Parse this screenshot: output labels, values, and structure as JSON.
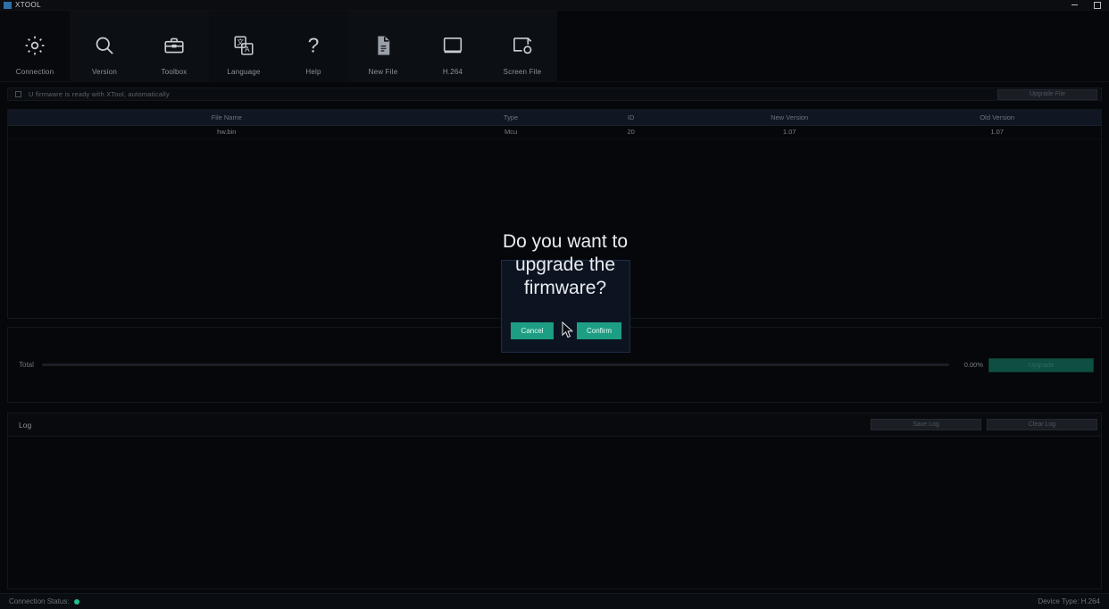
{
  "window": {
    "title": "XTOOL",
    "minimize_label": "Minimize",
    "maximize_label": "Maximize"
  },
  "toolbar": {
    "items": [
      {
        "label": "Connection",
        "icon": "gear-icon"
      },
      {
        "label": "Version",
        "icon": "magnifier-icon"
      },
      {
        "label": "Toolbox",
        "icon": "toolbox-icon"
      },
      {
        "label": "Language",
        "icon": "translate-icon"
      },
      {
        "label": "Help",
        "icon": "question-mark-icon"
      },
      {
        "label": "New File",
        "icon": "document-icon"
      },
      {
        "label": "H.264",
        "icon": "screen-icon"
      },
      {
        "label": "Screen File",
        "icon": "screen-settings-icon"
      }
    ]
  },
  "auto_update": {
    "checkbox_checked": false,
    "label": "U firmware is ready with XTool, automatically",
    "action_label": "Upgrade File"
  },
  "firmware_table": {
    "columns": [
      "File Name",
      "Type",
      "ID",
      "New Version",
      "Old Version"
    ],
    "rows": [
      {
        "file_name": "hw.bin",
        "type": "Mcu",
        "id": "20",
        "new_version": "1.07",
        "old_version": "1.07"
      }
    ]
  },
  "progress": {
    "label": "Total",
    "percent_text": "0.00%",
    "percent_value": 0,
    "upgrade_label": "Upgrade"
  },
  "log": {
    "label": "Log",
    "save_label": "Save Log",
    "clear_label": "Clear Log",
    "content": ""
  },
  "status_bar": {
    "connection_label": "Connection Status:",
    "device_label": "Device Type: H.264"
  },
  "dialog": {
    "message": "Do you want to upgrade the firmware?",
    "cancel_label": "Cancel",
    "confirm_label": "Confirm"
  },
  "colors": {
    "accent_teal": "#1d9e84",
    "status_green": "#21c08f",
    "background": "#05070a",
    "panel_border": "#13171c"
  }
}
